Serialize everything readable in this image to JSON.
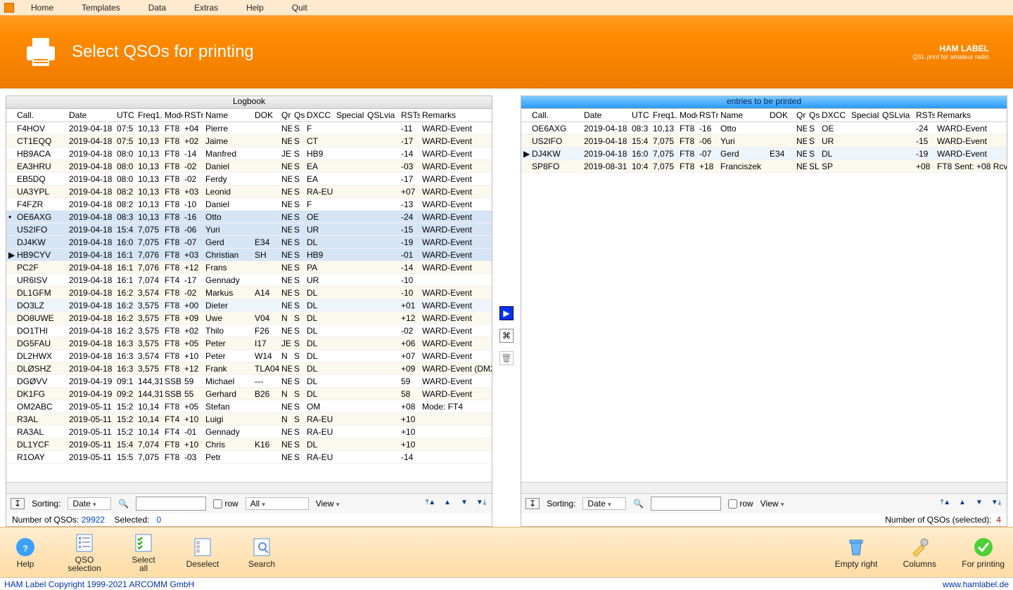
{
  "menu": {
    "home": "Home",
    "templates": "Templates",
    "data": "Data",
    "extras": "Extras",
    "help": "Help",
    "quit": "Quit"
  },
  "header": {
    "title": "Select QSOs for printing",
    "brand": "HAM LABEL",
    "brand_sub": "QSL print for amateur radio"
  },
  "panes": {
    "logbook_title": "Logbook",
    "print_title": "entries to be printed"
  },
  "columns": [
    "",
    "Call.",
    "Date",
    "UTC",
    "Freq1.",
    "Mode",
    "RSTr",
    "Name",
    "DOK",
    "Qr",
    "Qs",
    "DXCC",
    "Special",
    "QSLvia",
    "RSTs",
    "Remarks"
  ],
  "logbook_rows": [
    {
      "call": "F4HOV",
      "date": "2019-04-18",
      "utc": "07:5",
      "freq": "10,13",
      "mode": "FT8",
      "rstr": "+04",
      "name": "Pierre",
      "dok": "",
      "qr": "NE",
      "qs": "S",
      "dxcc": "F",
      "special": "",
      "qslvia": "",
      "rsts": "-11",
      "remarks": "WARD-Event"
    },
    {
      "call": "CT1EQQ",
      "date": "2019-04-18",
      "utc": "07:5",
      "freq": "10,13",
      "mode": "FT8",
      "rstr": "+02",
      "name": "Jaime",
      "dok": "",
      "qr": "NE",
      "qs": "S",
      "dxcc": "CT",
      "special": "",
      "qslvia": "",
      "rsts": "-17",
      "remarks": "WARD-Event"
    },
    {
      "call": "HB9ACA",
      "date": "2019-04-18",
      "utc": "08:0",
      "freq": "10,13",
      "mode": "FT8",
      "rstr": "-14",
      "name": "Manfred",
      "dok": "",
      "qr": "JE",
      "qs": "S",
      "dxcc": "HB9",
      "special": "",
      "qslvia": "",
      "rsts": "-14",
      "remarks": "WARD-Event"
    },
    {
      "call": "EA3HRU",
      "date": "2019-04-18",
      "utc": "08:0",
      "freq": "10,13",
      "mode": "FT8",
      "rstr": "-02",
      "name": "Daniel",
      "dok": "",
      "qr": "NE",
      "qs": "S",
      "dxcc": "EA",
      "special": "",
      "qslvia": "",
      "rsts": "-03",
      "remarks": "WARD-Event"
    },
    {
      "call": "EB5DQ",
      "date": "2019-04-18",
      "utc": "08:0",
      "freq": "10,13",
      "mode": "FT8",
      "rstr": "-02",
      "name": "Ferdy",
      "dok": "",
      "qr": "NE",
      "qs": "S",
      "dxcc": "EA",
      "special": "",
      "qslvia": "",
      "rsts": "-17",
      "remarks": "WARD-Event"
    },
    {
      "call": "UA3YPL",
      "date": "2019-04-18",
      "utc": "08:2",
      "freq": "10,13",
      "mode": "FT8",
      "rstr": "+03",
      "name": "Leonid",
      "dok": "",
      "qr": "NE",
      "qs": "S",
      "dxcc": "RA-EU",
      "special": "",
      "qslvia": "",
      "rsts": "+07",
      "remarks": "WARD-Event"
    },
    {
      "call": "F4FZR",
      "date": "2019-04-18",
      "utc": "08:2",
      "freq": "10,13",
      "mode": "FT8",
      "rstr": "-10",
      "name": "Daniel",
      "dok": "",
      "qr": "NE",
      "qs": "S",
      "dxcc": "F",
      "special": "",
      "qslvia": "",
      "rsts": "-13",
      "remarks": "WARD-Event"
    },
    {
      "sel": true,
      "mark": "•",
      "call": "OE6AXG",
      "date": "2019-04-18",
      "utc": "08:3",
      "freq": "10,13",
      "mode": "FT8",
      "rstr": "-16",
      "name": "Otto",
      "dok": "",
      "qr": "NE",
      "qs": "S",
      "dxcc": "OE",
      "special": "",
      "qslvia": "",
      "rsts": "-24",
      "remarks": "WARD-Event"
    },
    {
      "sel": true,
      "call": "US2IFO",
      "date": "2019-04-18",
      "utc": "15:4",
      "freq": "7,075",
      "mode": "FT8",
      "rstr": "-06",
      "name": "Yuri",
      "dok": "",
      "qr": "NE",
      "qs": "S",
      "dxcc": "UR",
      "special": "",
      "qslvia": "",
      "rsts": "-15",
      "remarks": "WARD-Event"
    },
    {
      "sel": true,
      "call": "DJ4KW",
      "date": "2019-04-18",
      "utc": "16:0",
      "freq": "7,075",
      "mode": "FT8",
      "rstr": "-07",
      "name": "Gerd",
      "dok": "E34",
      "qr": "NE",
      "qs": "S",
      "dxcc": "DL",
      "special": "",
      "qslvia": "",
      "rsts": "-19",
      "remarks": "WARD-Event"
    },
    {
      "sel": true,
      "mark": "▶",
      "call": "HB9CYV",
      "date": "2019-04-18",
      "utc": "16:1",
      "freq": "7,076",
      "mode": "FT8",
      "rstr": "+03",
      "name": "Christian",
      "dok": "SH",
      "qr": "NE",
      "qs": "S",
      "dxcc": "HB9",
      "special": "",
      "qslvia": "",
      "rsts": "-01",
      "remarks": "WARD-Event"
    },
    {
      "call": "PC2F",
      "date": "2019-04-18",
      "utc": "16:1",
      "freq": "7,076",
      "mode": "FT8",
      "rstr": "+12",
      "name": "Frans",
      "dok": "",
      "qr": "NE",
      "qs": "S",
      "dxcc": "PA",
      "special": "",
      "qslvia": "",
      "rsts": "-14",
      "remarks": "WARD-Event"
    },
    {
      "call": "UR6ISV",
      "date": "2019-04-18",
      "utc": "16:1",
      "freq": "7,074",
      "mode": "FT4",
      "rstr": "-17",
      "name": "Gennady",
      "dok": "",
      "qr": "NE",
      "qs": "S",
      "dxcc": "UR",
      "special": "",
      "qslvia": "",
      "rsts": "-10",
      "remarks": ""
    },
    {
      "call": "DL1GFM",
      "date": "2019-04-18",
      "utc": "16:2",
      "freq": "3,574",
      "mode": "FT8",
      "rstr": "-02",
      "name": "Markus",
      "dok": "A14",
      "qr": "NE",
      "qs": "S",
      "dxcc": "DL",
      "special": "",
      "qslvia": "",
      "rsts": "-10",
      "remarks": "WARD-Event"
    },
    {
      "cursor": true,
      "call": "DO3LZ",
      "date": "2019-04-18",
      "utc": "16:2",
      "freq": "3,575",
      "mode": "FT8",
      "rstr": "+00",
      "name": "Dieter",
      "dok": "",
      "qr": "NE",
      "qs": "S",
      "dxcc": "DL",
      "special": "",
      "qslvia": "",
      "rsts": "+01",
      "remarks": "WARD-Event"
    },
    {
      "call": "DO8UWE",
      "date": "2019-04-18",
      "utc": "16:2",
      "freq": "3,575",
      "mode": "FT8",
      "rstr": "+09",
      "name": "Uwe",
      "dok": "V04",
      "qr": "N",
      "qs": "S",
      "dxcc": "DL",
      "special": "",
      "qslvia": "",
      "rsts": "+12",
      "remarks": "WARD-Event"
    },
    {
      "call": "DO1THI",
      "date": "2019-04-18",
      "utc": "16:2",
      "freq": "3,575",
      "mode": "FT8",
      "rstr": "+02",
      "name": "Thilo",
      "dok": "F26",
      "qr": "NE",
      "qs": "S",
      "dxcc": "DL",
      "special": "",
      "qslvia": "",
      "rsts": "-02",
      "remarks": "WARD-Event"
    },
    {
      "call": "DG5FAU",
      "date": "2019-04-18",
      "utc": "16:3",
      "freq": "3,575",
      "mode": "FT8",
      "rstr": "+05",
      "name": "Peter",
      "dok": "I17",
      "qr": "JE",
      "qs": "S",
      "dxcc": "DL",
      "special": "",
      "qslvia": "",
      "rsts": "+06",
      "remarks": "WARD-Event"
    },
    {
      "call": "DL2HWX",
      "date": "2019-04-18",
      "utc": "16:3",
      "freq": "3,574",
      "mode": "FT8",
      "rstr": "+10",
      "name": "Peter",
      "dok": "W14",
      "qr": "N",
      "qs": "S",
      "dxcc": "DL",
      "special": "",
      "qslvia": "",
      "rsts": "+07",
      "remarks": "WARD-Event"
    },
    {
      "call": "DLØSHZ",
      "date": "2019-04-18",
      "utc": "16:3",
      "freq": "3,575",
      "mode": "FT8",
      "rstr": "+12",
      "name": "Frank",
      "dok": "TLA04",
      "qr": "NE",
      "qs": "S",
      "dxcc": "DL",
      "special": "",
      "qslvia": "",
      "rsts": "+09",
      "remarks": "WARD-Event (DM2"
    },
    {
      "call": "DGØVV",
      "date": "2019-04-19",
      "utc": "09:1",
      "freq": "144,31",
      "mode": "SSB",
      "rstr": "59",
      "name": "Michael",
      "dok": "---",
      "qr": "NE",
      "qs": "S",
      "dxcc": "DL",
      "special": "",
      "qslvia": "",
      "rsts": "59",
      "remarks": "WARD-Event"
    },
    {
      "call": "DK1FG",
      "date": "2019-04-19",
      "utc": "09:2",
      "freq": "144,31",
      "mode": "SSB",
      "rstr": "55",
      "name": "Gerhard",
      "dok": "B26",
      "qr": "N",
      "qs": "S",
      "dxcc": "DL",
      "special": "",
      "qslvia": "",
      "rsts": "58",
      "remarks": "WARD-Event"
    },
    {
      "call": "OM2ABC",
      "date": "2019-05-11",
      "utc": "15:2",
      "freq": "10,14",
      "mode": "FT8",
      "rstr": "+05",
      "name": "Stefan",
      "dok": "",
      "qr": "NE",
      "qs": "S",
      "dxcc": "OM",
      "special": "",
      "qslvia": "",
      "rsts": "+08",
      "remarks": "Mode: FT4"
    },
    {
      "call": "R3AL",
      "date": "2019-05-11",
      "utc": "15:2",
      "freq": "10,14",
      "mode": "FT4",
      "rstr": "+10",
      "name": "Luigi",
      "dok": "",
      "qr": "N",
      "qs": "S",
      "dxcc": "RA-EU",
      "special": "",
      "qslvia": "",
      "rsts": "+10",
      "remarks": ""
    },
    {
      "call": "RA3AL",
      "date": "2019-05-11",
      "utc": "15:2",
      "freq": "10,14",
      "mode": "FT4",
      "rstr": "-01",
      "name": "Gennady",
      "dok": "",
      "qr": "NE",
      "qs": "S",
      "dxcc": "RA-EU",
      "special": "",
      "qslvia": "",
      "rsts": "+10",
      "remarks": ""
    },
    {
      "call": "DL1YCF",
      "date": "2019-05-11",
      "utc": "15:4",
      "freq": "7,074",
      "mode": "FT8",
      "rstr": "+10",
      "name": "Chris",
      "dok": "K16",
      "qr": "NE",
      "qs": "S",
      "dxcc": "DL",
      "special": "",
      "qslvia": "",
      "rsts": "+10",
      "remarks": ""
    },
    {
      "call": "R1OAY",
      "date": "2019-05-11",
      "utc": "15:5",
      "freq": "7,075",
      "mode": "FT8",
      "rstr": "-03",
      "name": "Petr",
      "dok": "",
      "qr": "NE",
      "qs": "S",
      "dxcc": "RA-EU",
      "special": "",
      "qslvia": "",
      "rsts": "-14",
      "remarks": ""
    }
  ],
  "print_rows": [
    {
      "call": "OE6AXG",
      "date": "2019-04-18",
      "utc": "08:3",
      "freq": "10,13",
      "mode": "FT8",
      "rstr": "-16",
      "name": "Otto",
      "dok": "",
      "qr": "NE",
      "qs": "S",
      "dxcc": "OE",
      "special": "",
      "qslvia": "",
      "rsts": "-24",
      "remarks": "WARD-Event"
    },
    {
      "call": "US2IFO",
      "date": "2019-04-18",
      "utc": "15:4",
      "freq": "7,075",
      "mode": "FT8",
      "rstr": "-06",
      "name": "Yuri",
      "dok": "",
      "qr": "NE",
      "qs": "S",
      "dxcc": "UR",
      "special": "",
      "qslvia": "",
      "rsts": "-15",
      "remarks": "WARD-Event"
    },
    {
      "mark": "▶",
      "cursor": true,
      "call": "DJ4KW",
      "date": "2019-04-18",
      "utc": "16:0",
      "freq": "7,075",
      "mode": "FT8",
      "rstr": "-07",
      "name": "Gerd",
      "dok": "E34",
      "qr": "NE",
      "qs": "S",
      "dxcc": "DL",
      "special": "",
      "qslvia": "",
      "rsts": "-19",
      "remarks": "WARD-Event"
    },
    {
      "call": "SP8FO",
      "date": "2019-08-31",
      "utc": "10:4",
      "freq": "7,075",
      "mode": "FT8",
      "rstr": "+18",
      "name": "Franciszek",
      "dok": "",
      "qr": "NE",
      "qs": "SL",
      "dxcc": "SP",
      "special": "",
      "qslvia": "",
      "rsts": "+08",
      "remarks": "FT8  Sent: +08  Rcv"
    }
  ],
  "footer": {
    "sorting": "Sorting:",
    "sort_field": "Date",
    "row_cb": "row",
    "all": "All",
    "view": "View",
    "log_status_a": "Number of QSOs:",
    "log_count": "29922",
    "sel_label": "Selected:",
    "sel_count": "0",
    "print_status": "Number of QSOs (selected):",
    "print_count": "4"
  },
  "toolbar": {
    "help": "Help",
    "qso_sel": "QSO\nselection",
    "select_all": "Select\nall",
    "deselect": "Deselect",
    "search": "Search",
    "empty": "Empty right",
    "columns": "Columns",
    "for_print": "For printing"
  },
  "statusbar": {
    "left": "HAM Label Copyright 1999-2021 ARCOMM GmbH",
    "right": "www.hamlabel.de"
  }
}
